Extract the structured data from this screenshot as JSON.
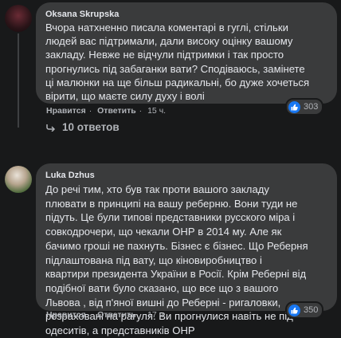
{
  "comments": [
    {
      "author": "Oksana Skrupska",
      "text": "Вчора натхненно писала коментарі в гуглі, стільки\nлюдей вас підтримали, дали високу оцінку вашому\nзакладу. Невже не відчули підтримки і так просто\nпрогнулись під забаганки вати? Сподіваюсь, замінете\nці малюнки на ще більш радикальні, бо дуже хочеться\nвірити, що маєте силу духу і волі",
      "like_label": "Нравится",
      "reply_label": "Ответить",
      "time": "15 ч.",
      "reactions_count": "303"
    },
    {
      "author": "Luka Dzhus",
      "text": "До речі тим, хто був так проти вашого закладу\nплювати в принципі на вашу реберню. Вони туди не\nпідуть. Це були типові представники русского міра і\nсовкодрочери, що чекали ОНР в 2014 му. Але як\nбачимо гроші не пахнуть. Бізнес є бізнес. Що Реберня\nпідлаштована під вату, що кіновиробництво і\nквартири президента України в Росії. Крім Реберні від\nподібної вати було сказано, що все що з вашого\nЛьвова , від п'яної вишні до Реберні - ригаловки,\nрозраховані на рагуля. Ви прогнулися навіть не під\nодеситів, а представників ОНР",
      "like_label": "Нравится",
      "reply_label": "Ответить",
      "time": "17 ч.",
      "reactions_count": "350"
    }
  ],
  "replies_label": "10 ответов",
  "icons": {
    "like": "thumbs-up-icon",
    "reply_arrow": "reply-arrow-icon"
  },
  "colors": {
    "background": "#18191a",
    "bubble": "#3a3b3c",
    "text": "#e4e6eb",
    "secondary": "#b0b3b8",
    "like_blue": "#1877f2"
  }
}
